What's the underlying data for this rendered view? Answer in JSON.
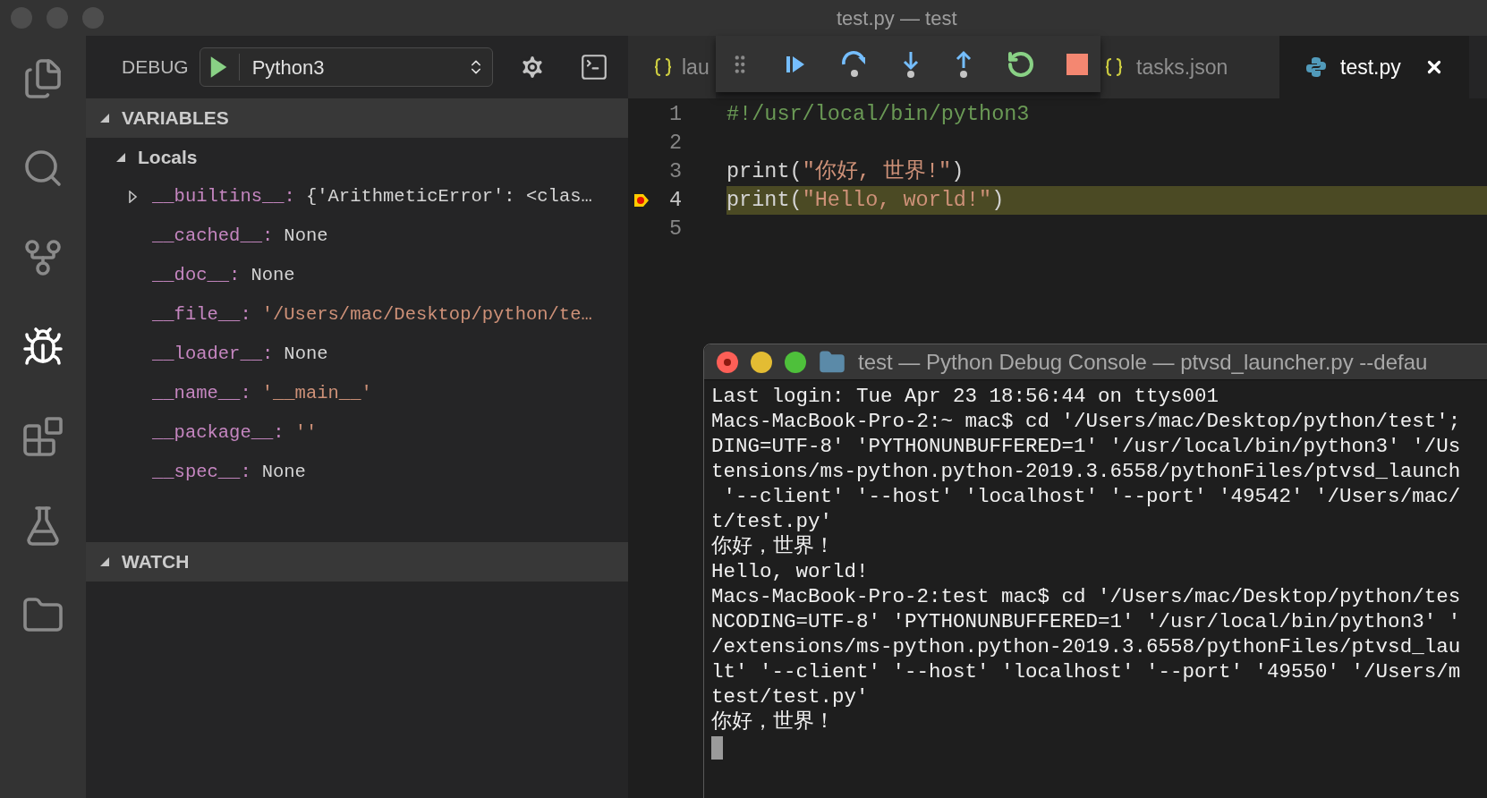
{
  "window": {
    "title": "test.py — test"
  },
  "activity_bar": [
    {
      "kind": "files",
      "selected": false
    },
    {
      "kind": "search",
      "selected": false
    },
    {
      "kind": "source_control",
      "selected": false
    },
    {
      "kind": "debug",
      "selected": true
    },
    {
      "kind": "extensions",
      "selected": false
    },
    {
      "kind": "test",
      "selected": false
    },
    {
      "kind": "folder",
      "selected": false
    }
  ],
  "debug_header": {
    "label": "DEBUG",
    "configuration": "Python3"
  },
  "sections": [
    {
      "title": "VARIABLES",
      "expanded": true,
      "scopes": [
        {
          "name": "Locals",
          "expanded": true,
          "variables": [
            {
              "name": "__builtins__:",
              "value": "{'ArithmeticError': <clas…",
              "kind": "plain",
              "expandable": true
            },
            {
              "name": "__cached__:",
              "value": "None",
              "kind": "plain",
              "expandable": false
            },
            {
              "name": "__doc__:",
              "value": "None",
              "kind": "plain",
              "expandable": false
            },
            {
              "name": "__file__:",
              "value": "'/Users/mac/Desktop/python/te…",
              "kind": "string",
              "expandable": false
            },
            {
              "name": "__loader__:",
              "value": "None",
              "kind": "plain",
              "expandable": false
            },
            {
              "name": "__name__:",
              "value": "'__main__'",
              "kind": "string",
              "expandable": false
            },
            {
              "name": "__package__:",
              "value": "''",
              "kind": "string",
              "expandable": false
            },
            {
              "name": "__spec__:",
              "value": "None",
              "kind": "plain",
              "expandable": false
            }
          ]
        }
      ]
    },
    {
      "title": "WATCH",
      "expanded": true
    }
  ],
  "tabs": [
    {
      "label": "lau",
      "kind": "json",
      "selected": false,
      "closable": false
    },
    {
      "label": "tasks.json",
      "kind": "json",
      "selected": false,
      "closable": false
    },
    {
      "label": "test.py",
      "kind": "python",
      "selected": true,
      "closable": true
    }
  ],
  "debug_toolbar": [
    {
      "kind": "grip"
    },
    {
      "kind": "continue"
    },
    {
      "kind": "step_over"
    },
    {
      "kind": "step_into"
    },
    {
      "kind": "step_out"
    },
    {
      "kind": "restart"
    },
    {
      "kind": "stop"
    }
  ],
  "editor": {
    "lines": [
      {
        "number": "1",
        "current": false,
        "tokens": [
          {
            "kind": "comment",
            "text": "#!/usr/local/bin/python3"
          }
        ]
      },
      {
        "number": "2",
        "current": false
      },
      {
        "number": "3",
        "current": false,
        "tokens": [
          {
            "kind": "plain",
            "text": "print("
          },
          {
            "kind": "string",
            "text": "\"你好, 世界!\""
          },
          {
            "kind": "plain",
            "text": ")"
          }
        ]
      },
      {
        "number": "4",
        "current": true,
        "tokens": [
          {
            "kind": "plain",
            "text": "print("
          },
          {
            "kind": "string",
            "text": "\"Hello, world!\""
          },
          {
            "kind": "plain",
            "text": ")"
          }
        ]
      },
      {
        "number": "5",
        "current": false
      }
    ]
  },
  "terminal": {
    "title": "test — Python Debug Console — ptvsd_launcher.py --defau",
    "cursor": true,
    "lines": [
      "Last login: Tue Apr 23 18:56:44 on ttys001",
      "Macs-MacBook-Pro-2:~ mac$ cd '/Users/mac/Desktop/python/test';",
      "DING=UTF-8' 'PYTHONUNBUFFERED=1' '/usr/local/bin/python3' '/Us",
      "tensions/ms-python.python-2019.3.6558/pythonFiles/ptvsd_launch",
      " '--client' '--host' 'localhost' '--port' '49542' '/Users/mac/",
      "t/test.py'",
      "你好，世界！",
      "Hello, world!",
      "Macs-MacBook-Pro-2:test mac$ cd '/Users/mac/Desktop/python/tes",
      "NCODING=UTF-8' 'PYTHONUNBUFFERED=1' '/usr/local/bin/python3' '",
      "/extensions/ms-python.python-2019.3.6558/pythonFiles/ptvsd_lau",
      "lt' '--client' '--host' 'localhost' '--port' '49550' '/Users/m",
      "test/test.py'",
      "你好，世界！"
    ]
  }
}
